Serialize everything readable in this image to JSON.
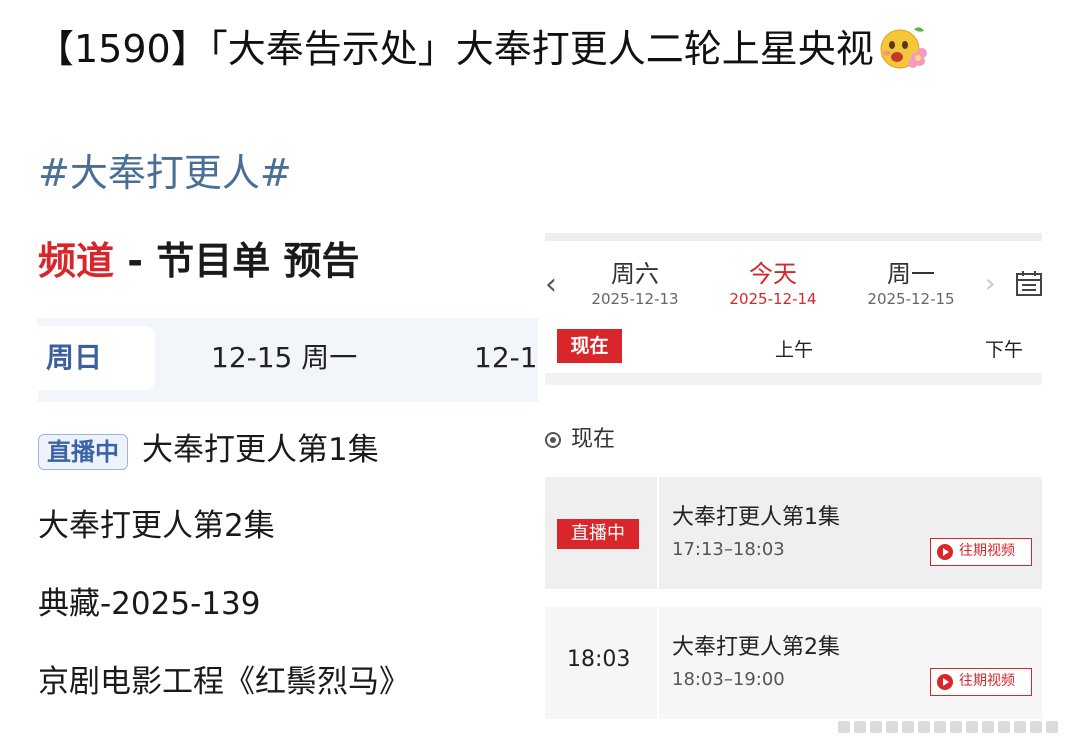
{
  "post": {
    "title": "【1590】「大奉告示处」大奉打更人二轮上星央视",
    "emoji_icon": "flower-smile-emoji",
    "hashtag": "#大奉打更人#"
  },
  "left_screenshot": {
    "header_red": "频道",
    "header_dash": " - ",
    "header_rest": "节目单 预告",
    "tabs": [
      "周日",
      "12-15 周一",
      "12-1"
    ],
    "live_badge": "直播中",
    "programs": [
      "大奉打更人第1集",
      "大奉打更人第2集",
      "典藏-2025-139",
      "京剧电影工程《红鬃烈马》"
    ]
  },
  "right_screenshot": {
    "days": [
      {
        "name": "周六",
        "date": "2025-12-13"
      },
      {
        "name": "今天",
        "date": "2025-12-14"
      },
      {
        "name": "周一",
        "date": "2025-12-15"
      }
    ],
    "now_tag": "现在",
    "am": "上午",
    "pm": "下午",
    "now_label": "现在",
    "programs": [
      {
        "status": "直播中",
        "title": "大奉打更人第1集",
        "time": "17:13–18:03",
        "replay": "往期视频"
      },
      {
        "start": "18:03",
        "title": "大奉打更人第2集",
        "time": "18:03–19:00",
        "replay": "往期视频"
      }
    ],
    "accent_color": "#d8262a"
  }
}
